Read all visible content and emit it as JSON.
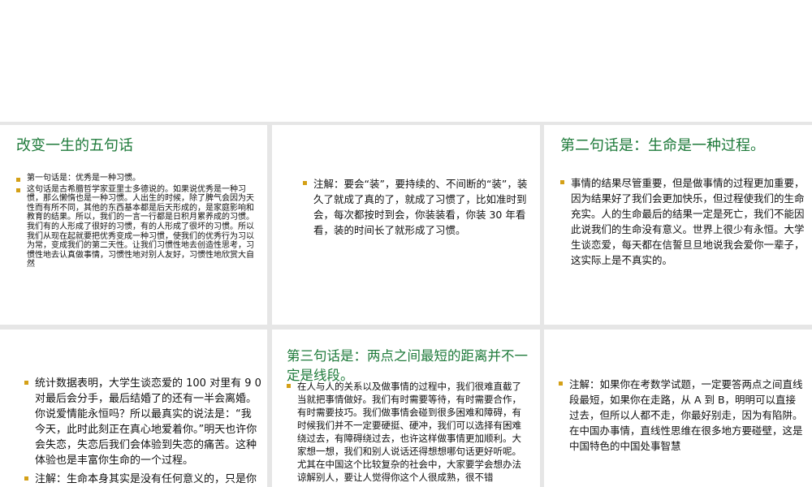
{
  "slides": [
    {
      "title": "改变一生的五句话",
      "bullets": [
        "第一句话是：优秀是一种习惯。",
        "这句话是古希腊哲学家亚里士多德说的。如果说优秀是一种习惯，那么懒惰也是一种习惯。人出生的时候，除了脾气会因为天性而有所不同，其他的东西基本都是后天形成的，是家庭影响和教育的结果。所以，我们的一言一行都是日积月累养成的习惯。我们有的人形成了很好的习惯，有的人形成了很坏的习惯。所以我们从现在起就要把优秀变成一种习惯，使我们的优秀行为习以为常，变成我们的第二天性。让我们习惯性地去创造性思考，习惯性地去认真做事情，习惯性地对别人友好，习惯性地欣赏大自然"
      ]
    },
    {
      "title": "",
      "bullets": [
        "注解：要会“装”，要持续的、不间断的“装”，装久了就成了真的了，就成了习惯了，比如准时到会，每次都按时到会，你装装看，你装 30 年看看，装的时间长了就形成了习惯。"
      ]
    },
    {
      "title": "第二句话是：生命是一种过程。",
      "bullets": [
        "事情的结果尽管重要，但是做事情的过程更加重要，因为结果好了我们会更加快乐，但过程使我们的生命充实。人的生命最后的结果一定是死亡，我们不能因此说我们的生命没有意义。世界上很少有永恒。大学生谈恋爱，每天都在信誓旦旦地说我会爱你一辈子，这实际上是不真实的。"
      ]
    },
    {
      "title": "",
      "bullets": [
        "统计数据表明，大学生谈恋爱的 100 对里有 9 0 对最后会分手，最后结婚了的还有一半会离婚。你说爱情能永恒吗？所以最真实的说法是：“我今天，此时此刻正在真心地爱着你。”明天也许你会失恋，失恋后我们会体验到失恋的痛苦。这种体验也是丰富你生命的一个过程。",
        "注解：生命本身其实是没有任何意义的，只是你自己赋予你的生命一种你希望实现的意义，"
      ]
    },
    {
      "title": "第三句话是：两点之间最短的距离并不一定是线段。",
      "bullets": [
        "在人与人的关系以及做事情的过程中，我们很难直截了当就把事情做好。我们有时需要等待，有时需要合作，有时需要技巧。我们做事情会碰到很多困难和障碍，有时候我们并不一定要硬挺、硬冲，我们可以选择有困难绕过去，有障碍绕过去，也许这样做事情更加顺利。大家想一想，我们和别人说话还得想想哪句话更好听呢。尤其在中国这个比较复杂的社会中，大家要学会想办法谅解别人，要让人觉得你这个人很成熟，很不错"
      ]
    },
    {
      "title": "",
      "bullets": [
        "注解：如果你在考数学试题，一定要答两点之间直线段最短，如果你在走路，从 A 到 B，明明可以直接过去，但所以人都不走，你最好别走，因为有陷阱。在中国办事情，直线性思维在很多地方要碰壁，这是中国特色的中国处事智慧"
      ]
    }
  ]
}
